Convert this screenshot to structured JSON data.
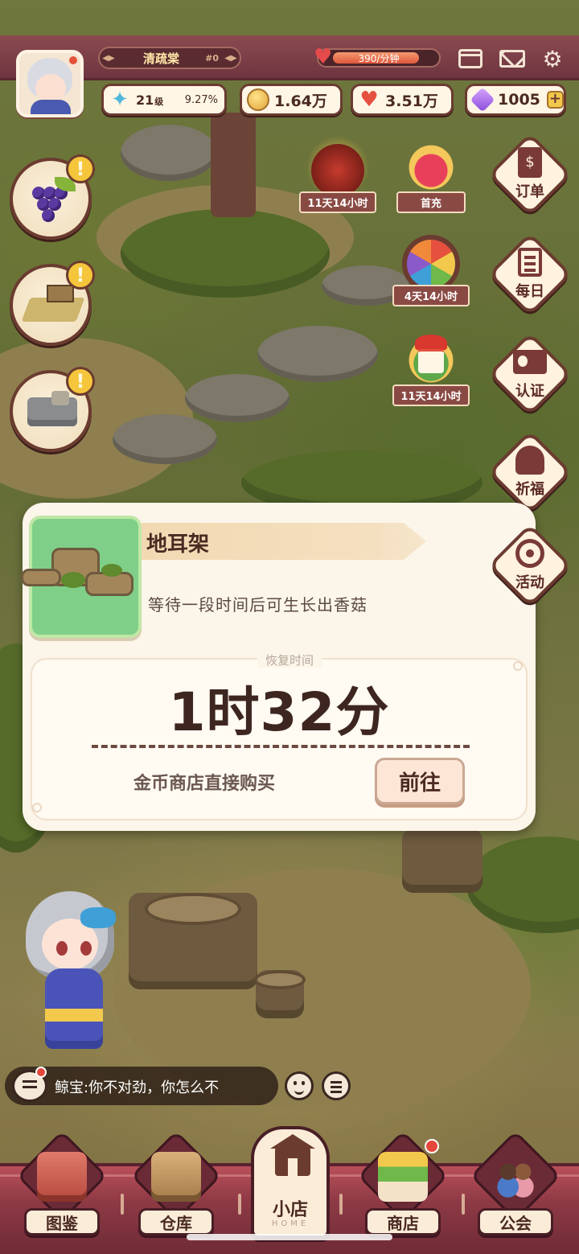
{
  "header": {
    "shop_name": "清疏棠",
    "shop_id": "#0",
    "love_rate": "390/分钟",
    "love_rate_fill": 0.82
  },
  "stats": {
    "level": "21",
    "level_unit": "级",
    "exp_percent": "9.27%",
    "coins": "1.64万",
    "hearts": "3.51万",
    "gems": "1005"
  },
  "events": [
    {
      "label": "11天14小时",
      "icon": "firework-event-icon"
    },
    {
      "label": "首充",
      "icon": "gift-box-icon"
    },
    {
      "label": "4天14小时",
      "icon": "prize-wheel-icon"
    },
    {
      "label": "11天14小时",
      "icon": "christmas-notice-icon"
    }
  ],
  "side_menu": [
    {
      "label": "订单",
      "icon": "order-icon"
    },
    {
      "label": "每日",
      "icon": "daily-icon"
    },
    {
      "label": "认证",
      "icon": "id-card-icon"
    },
    {
      "label": "祈福",
      "icon": "pray-icon"
    },
    {
      "label": "活动",
      "icon": "activity-icon"
    }
  ],
  "quests": [
    {
      "icon": "grapes-icon"
    },
    {
      "icon": "field-icon"
    },
    {
      "icon": "machine-icon"
    }
  ],
  "panel": {
    "title": "地耳架",
    "description": "等待一段时间后可生长出香菇",
    "section_label": "恢复时间",
    "timer": "1时32分",
    "buy_text": "金币商店直接购买",
    "go_button": "前往"
  },
  "chat": {
    "message": "鲸宝:你不对劲，你怎么不"
  },
  "nav": {
    "items": [
      {
        "label": "图鉴"
      },
      {
        "label": "仓库"
      },
      {
        "label": "小店",
        "sub": "HOME"
      },
      {
        "label": "商店"
      },
      {
        "label": "公会"
      }
    ]
  },
  "colors": {
    "brand_bar": "#8c4a50",
    "panel_bg": "#fbf5ea",
    "alert_yellow": "#f5c63b"
  }
}
